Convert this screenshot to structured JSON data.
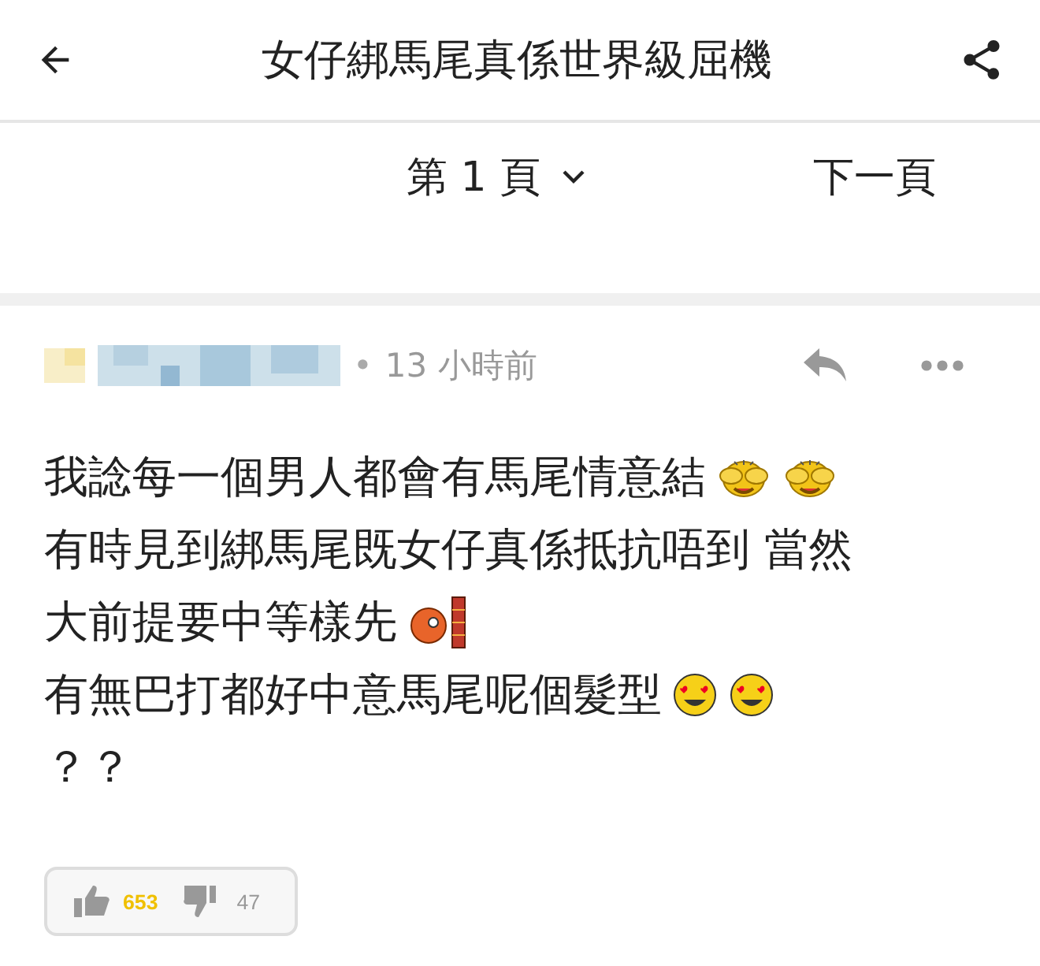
{
  "header": {
    "title": "女仔綁馬尾真係世界級屈機"
  },
  "pager": {
    "current": "第 1 頁",
    "next": "下一頁"
  },
  "comment": {
    "separator": "•",
    "time": "13 小時前",
    "lines": [
      {
        "text": "我諗每一個男人都會有馬尾情意結",
        "emojis": [
          {
            "kind": "cover-face"
          },
          {
            "kind": "cover-face"
          }
        ]
      },
      {
        "text": "有時見到綁馬尾既女仔真係抵抗唔到 當然"
      },
      {
        "text": "大前提要中等樣先",
        "emojis": [
          {
            "kind": "wall-bang"
          }
        ]
      },
      {
        "text": "有無巴打都好中意馬尾呢個髮型",
        "emojis": [
          {
            "kind": "heart-eyes"
          },
          {
            "kind": "heart-eyes"
          }
        ]
      },
      {
        "text": "？？"
      }
    ],
    "likes": "653",
    "dislikes": "47"
  }
}
